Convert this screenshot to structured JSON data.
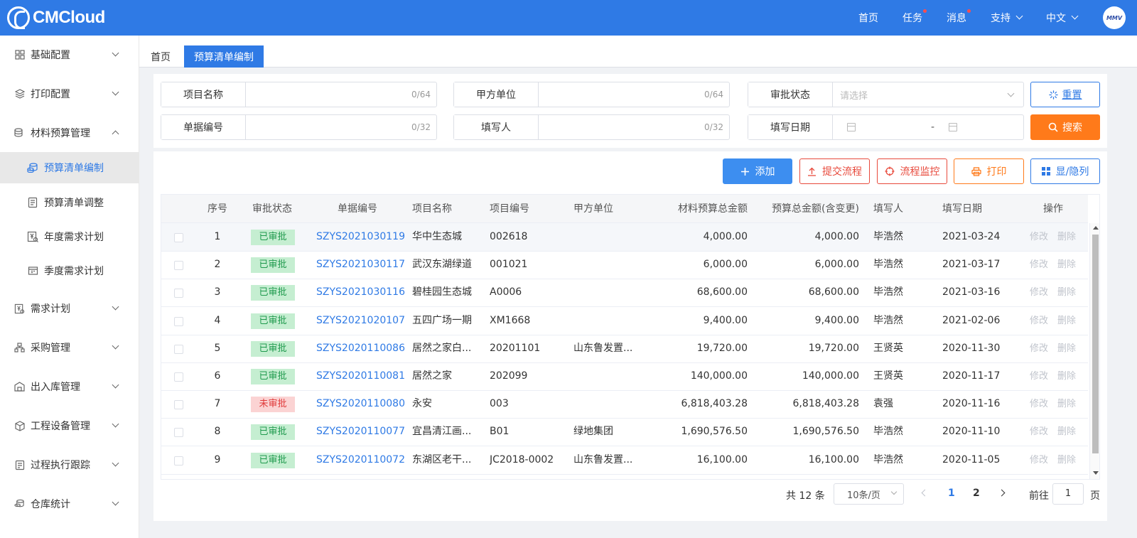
{
  "header": {
    "logo_text": "CMCloud",
    "nav": [
      {
        "label": "首页",
        "dot": false,
        "chevron": false
      },
      {
        "label": "任务",
        "dot": true,
        "chevron": false
      },
      {
        "label": "消息",
        "dot": true,
        "chevron": false
      },
      {
        "label": "支持",
        "dot": false,
        "chevron": true
      },
      {
        "label": "中文",
        "dot": false,
        "chevron": true
      }
    ],
    "avatar_text": "MMV"
  },
  "sidebar": {
    "items": [
      {
        "label": "基础配置",
        "icon": "grid-icon",
        "expanded": false
      },
      {
        "label": "打印配置",
        "icon": "layers-icon",
        "expanded": false
      },
      {
        "label": "材料预算管理",
        "icon": "coins-icon",
        "expanded": true
      },
      {
        "label": "需求计划",
        "icon": "yen-search-icon",
        "expanded": false
      },
      {
        "label": "采购管理",
        "icon": "org-chart-icon",
        "expanded": false
      },
      {
        "label": "出入库管理",
        "icon": "warehouse-icon",
        "expanded": false
      },
      {
        "label": "工程设备管理",
        "icon": "cube-icon",
        "expanded": false
      },
      {
        "label": "过程执行跟踪",
        "icon": "checklist-icon",
        "expanded": false
      },
      {
        "label": "仓库统计",
        "icon": "coins-icon",
        "expanded": false
      }
    ],
    "subitems": [
      {
        "label": "预算清单编制",
        "icon": "coins-icon",
        "active": true
      },
      {
        "label": "预算清单调整",
        "icon": "document-icon",
        "active": false
      },
      {
        "label": "年度需求计划",
        "icon": "yen-search-icon",
        "active": false
      },
      {
        "label": "季度需求计划",
        "icon": "calendar-icon",
        "active": false
      }
    ]
  },
  "tabs": [
    {
      "label": "首页",
      "active": false
    },
    {
      "label": "预算清单编制",
      "active": true
    }
  ],
  "filters": {
    "project_name": {
      "label": "项目名称",
      "counter": "0/64"
    },
    "party_a": {
      "label": "甲方单位",
      "counter": "0/64"
    },
    "approval_status": {
      "label": "审批状态",
      "placeholder": "请选择"
    },
    "doc_no": {
      "label": "单据编号",
      "counter": "0/32"
    },
    "filler": {
      "label": "填写人",
      "counter": "0/32"
    },
    "fill_date": {
      "label": "填写日期",
      "separator": "-"
    },
    "reset_label": "重置",
    "search_label": "搜索"
  },
  "actions": {
    "add": "添加",
    "submit": "提交流程",
    "monitor": "流程监控",
    "print": "打印",
    "columns": "显/隐列"
  },
  "table": {
    "headers": [
      "序号",
      "审批状态",
      "单据编号",
      "项目名称",
      "项目编号",
      "甲方单位",
      "材料预算总金额",
      "预算总金额(含变更)",
      "填写人",
      "填写日期",
      "操作"
    ],
    "edit_label": "修改",
    "delete_label": "删除",
    "rows": [
      {
        "no": "1",
        "status": "已审批",
        "approved": true,
        "doc": "SZYS2021030119",
        "name": "华中生态城",
        "code": "002618",
        "party": "",
        "budget": "4,000.00",
        "total": "4,000.00",
        "filler": "毕浩然",
        "date": "2021-03-24"
      },
      {
        "no": "2",
        "status": "已审批",
        "approved": true,
        "doc": "SZYS2021030117",
        "name": "武汉东湖绿道",
        "code": "001021",
        "party": "",
        "budget": "6,000.00",
        "total": "6,000.00",
        "filler": "毕浩然",
        "date": "2021-03-17"
      },
      {
        "no": "3",
        "status": "已审批",
        "approved": true,
        "doc": "SZYS2021030116",
        "name": "碧桂园生态城",
        "code": "A0006",
        "party": "",
        "budget": "68,600.00",
        "total": "68,600.00",
        "filler": "毕浩然",
        "date": "2021-03-16"
      },
      {
        "no": "4",
        "status": "已审批",
        "approved": true,
        "doc": "SZYS2021020107",
        "name": "五四广场一期",
        "code": "XM1668",
        "party": "",
        "budget": "9,400.00",
        "total": "9,400.00",
        "filler": "毕浩然",
        "date": "2021-02-06"
      },
      {
        "no": "5",
        "status": "已审批",
        "approved": true,
        "doc": "SZYS2020110086",
        "name": "居然之家白...",
        "code": "20201101",
        "party": "山东鲁发置...",
        "budget": "19,720.00",
        "total": "19,720.00",
        "filler": "王贤英",
        "date": "2020-11-30"
      },
      {
        "no": "6",
        "status": "已审批",
        "approved": true,
        "doc": "SZYS2020110081",
        "name": "居然之家",
        "code": "202099",
        "party": "",
        "budget": "140,000.00",
        "total": "140,000.00",
        "filler": "王贤英",
        "date": "2020-11-17"
      },
      {
        "no": "7",
        "status": "未审批",
        "approved": false,
        "doc": "SZYS2020110080",
        "name": "永安",
        "code": "003",
        "party": "",
        "budget": "6,818,403.28",
        "total": "6,818,403.28",
        "filler": "袁强",
        "date": "2020-11-16"
      },
      {
        "no": "8",
        "status": "已审批",
        "approved": true,
        "doc": "SZYS2020110077",
        "name": "宜昌清江画...",
        "code": "B01",
        "party": "绿地集团",
        "budget": "1,690,576.50",
        "total": "1,690,576.50",
        "filler": "毕浩然",
        "date": "2020-11-10"
      },
      {
        "no": "9",
        "status": "已审批",
        "approved": true,
        "doc": "SZYS2020110072",
        "name": "东湖区老干...",
        "code": "JC2018-0002",
        "party": "山东鲁发置...",
        "budget": "16,100.00",
        "total": "16,100.00",
        "filler": "毕浩然",
        "date": "2020-11-05"
      }
    ]
  },
  "pagination": {
    "total": "共 12 条",
    "page_size": "10条/页",
    "pages": [
      "1",
      "2"
    ],
    "current": "1",
    "goto_label": "前往",
    "goto_value": "1",
    "page_label": "页"
  }
}
